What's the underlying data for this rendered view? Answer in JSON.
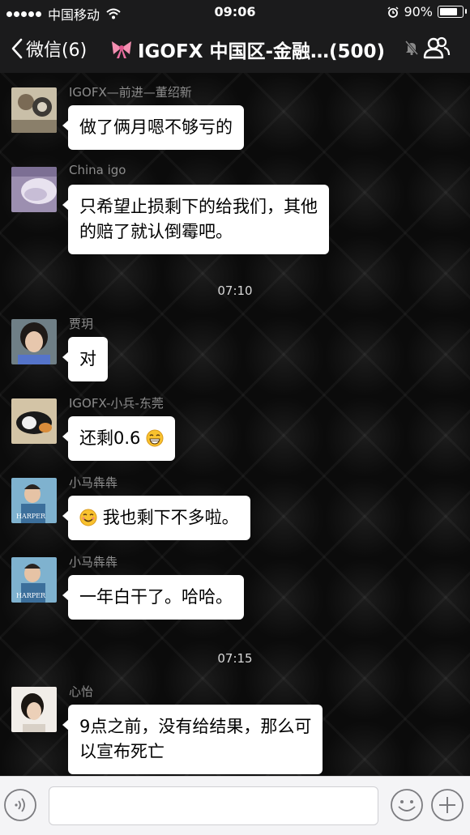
{
  "status_bar": {
    "carrier": "中国移动",
    "time": "09:06",
    "battery_text": "90%",
    "battery_level": 0.9,
    "icons": [
      "signal-dots-icon",
      "wifi-icon",
      "alarm-icon",
      "battery-icon"
    ]
  },
  "nav": {
    "back_label": "微信(6)",
    "title": "IGOFX 中国区-金融…(500)",
    "title_icon": "bow-emoji-icon",
    "icons": [
      "back-chevron-icon",
      "mute-bell-icon",
      "group-members-icon"
    ]
  },
  "chat": {
    "messages": [
      {
        "sender": "IGOFX—前进—董绍新",
        "lines": [
          "做了俩月嗯不够亏的"
        ]
      },
      {
        "sender": "China igo",
        "lines": [
          "只希望止损剩下的给我们，其他",
          "的赔了就认倒霉吧。"
        ]
      },
      {
        "timestamp": "07:10"
      },
      {
        "sender": "贾玥",
        "lines": [
          "对"
        ]
      },
      {
        "sender": "IGOFX-小兵-东莞",
        "lines": [
          "还剩0.6"
        ],
        "trailing_emoji": "grin-emoji-icon"
      },
      {
        "sender": "小马犇犇",
        "lines": [
          "我也剩下不多啦。"
        ],
        "leading_emoji": "smile-emoji-icon"
      },
      {
        "sender": "小马犇犇",
        "lines": [
          "一年白干了。哈哈。"
        ]
      },
      {
        "timestamp": "07:15"
      },
      {
        "sender": "心怡",
        "lines": [
          "9点之前，没有给结果，那么可",
          "以宣布死亡"
        ]
      }
    ]
  },
  "input_bar": {
    "text_value": "",
    "icons": [
      "voice-icon",
      "emoji-face-icon",
      "plus-icon"
    ]
  },
  "colors": {
    "bar_bg": "#1b1b1c",
    "chat_bg": "#0b0b0b",
    "bubble_bg": "#ffffff",
    "sender_text": "#8c8c8c",
    "timestamp_text": "#d8d8d8",
    "input_bar_bg": "#f4f4f6"
  }
}
